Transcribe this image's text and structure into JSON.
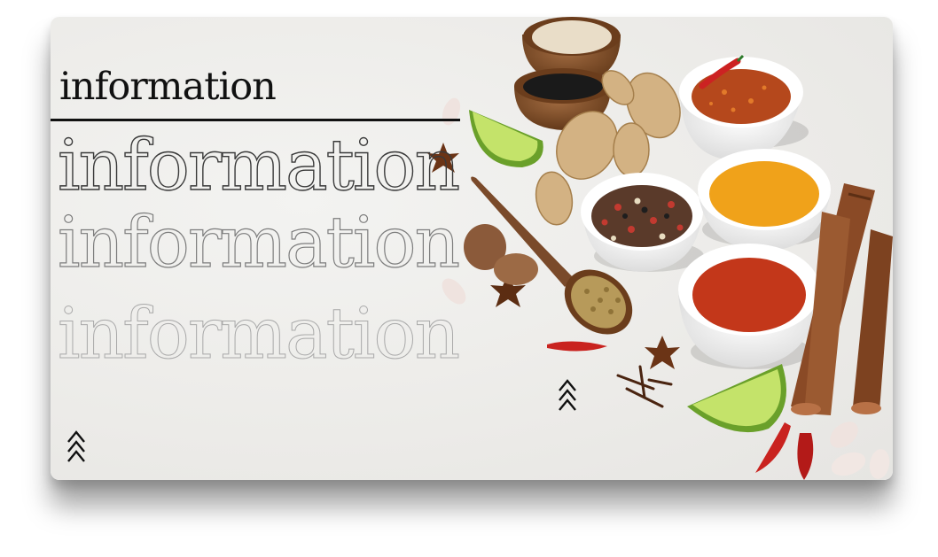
{
  "slide": {
    "heading": "information",
    "outline_lines": [
      "information",
      "information",
      "information"
    ]
  },
  "colors": {
    "background": "#ecebe8",
    "text": "#111111",
    "turmeric": "#f0a21a",
    "paprika": "#c3371a",
    "chili_flakes": "#b5481c",
    "cinnamon": "#8a4a26",
    "lime": "#9ccc3a",
    "wood": "#7a4a2a"
  },
  "icons": [
    "chevron-up-triple-icon"
  ]
}
